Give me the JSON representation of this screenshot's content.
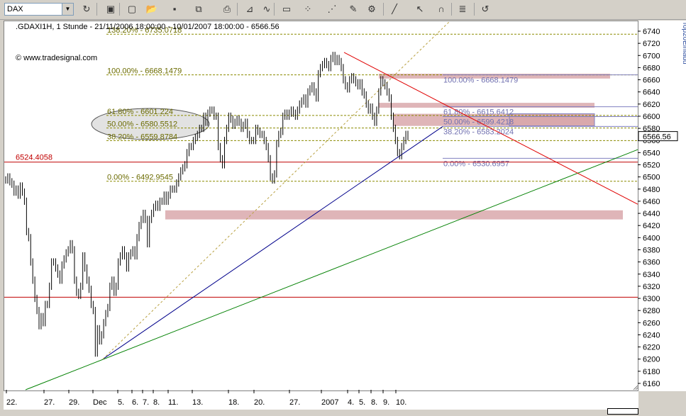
{
  "toolbar": {
    "symbol": "DAX",
    "icons": [
      "refresh-icon",
      "new-window-icon",
      "new-document-icon",
      "open-folder-icon",
      "save-icon",
      "copy-icon",
      "print-icon",
      "chart-window-icon",
      "indicator-icon",
      "bar-chart-icon",
      "scatter-icon",
      "trend-tools-icon",
      "drawing-tools-icon",
      "properties-icon",
      "cursor-icon",
      "arrow-pointer-icon",
      "magnet-icon",
      "list-icon",
      "undo-icon"
    ]
  },
  "chart": {
    "header": ".GDAXI1H, 1 Stunde - 21/11/2006 18:00:00 - 10/01/2007 18:00:00 - 6566.56",
    "watermark": "www.tradesignal.com",
    "sidebar_text": "Top20Einladu"
  },
  "chart_data": {
    "type": "bar",
    "subtype": "ohlc",
    "title": ".GDAXI1H, 1 Stunde - 21/11/2006 18:00:00 - 10/01/2007 18:00:00 - 6566.56",
    "x_tick_labels": [
      "22.",
      "27.",
      "29.",
      "Dec",
      "5.",
      "6.",
      "7.",
      "8.",
      "11.",
      "13.",
      "18.",
      "20.",
      "27.",
      "2007",
      "4.",
      "5.",
      "8.",
      "9.",
      "10."
    ],
    "y_tick_labels": [
      6160,
      6180,
      6200,
      6220,
      6240,
      6260,
      6280,
      6300,
      6320,
      6340,
      6360,
      6380,
      6400,
      6420,
      6440,
      6460,
      6480,
      6500,
      6520,
      6540,
      6560,
      6580,
      6600,
      6620,
      6640,
      6660,
      6680,
      6700,
      6720,
      6740
    ],
    "ylim": [
      6150,
      6750
    ],
    "last_price": "6566.56",
    "left_fib_levels": [
      {
        "label": "138.20% - 6735.0718",
        "value": 6735.0718
      },
      {
        "label": "100.00% - 6668.1479",
        "value": 6668.1479
      },
      {
        "label": "61.80% - 6601.224",
        "value": 6601.224
      },
      {
        "label": "50.00% - 6580.5512",
        "value": 6580.5512
      },
      {
        "label": "38.20% - 6559.8784",
        "value": 6559.8784
      },
      {
        "label": "0.00% - 6492.9545",
        "value": 6492.9545
      }
    ],
    "right_fib_levels": [
      {
        "label": "100.00% - 6668.1479",
        "value": 6668.1479
      },
      {
        "label": "61.80% - 6615.6412",
        "value": 6615.6412
      },
      {
        "label": "50.00% - 6599.4218",
        "value": 6599.4218
      },
      {
        "label": "38.20% - 6583.2024",
        "value": 6583.2024
      },
      {
        "label": "0.00% - 6530.6957",
        "value": 6530.6957
      }
    ],
    "horizontal_lines": [
      {
        "label": "6524.4058",
        "value": 6524.4058
      },
      {
        "value": 6302
      }
    ],
    "price_series": [
      6495,
      6500,
      6492,
      6488,
      6475,
      6480,
      6470,
      6485,
      6475,
      6460,
      6410,
      6400,
      6360,
      6330,
      6300,
      6280,
      6255,
      6270,
      6260,
      6290,
      6290,
      6320,
      6360,
      6360,
      6350,
      6340,
      6330,
      6355,
      6365,
      6375,
      6380,
      6390,
      6380,
      6330,
      6310,
      6305,
      6320,
      6370,
      6350,
      6330,
      6315,
      6290,
      6280,
      6210,
      6250,
      6230,
      6240,
      6260,
      6275,
      6285,
      6320,
      6330,
      6310,
      6320,
      6360,
      6370,
      6380,
      6370,
      6350,
      6370,
      6375,
      6380,
      6370,
      6400,
      6420,
      6430,
      6440,
      6430,
      6390,
      6430,
      6440,
      6450,
      6455,
      6450,
      6460,
      6460,
      6470,
      6460,
      6470,
      6480,
      6480,
      6480,
      6490,
      6500,
      6510,
      6515,
      6520,
      6540,
      6550,
      6550,
      6560,
      6565,
      6570,
      6580,
      6580,
      6600,
      6590,
      6605,
      6610,
      6610,
      6600,
      6600,
      6550,
      6530,
      6520,
      6560,
      6580,
      6600,
      6595,
      6585,
      6590,
      6595,
      6590,
      6580,
      6585,
      6590,
      6570,
      6560,
      6560,
      6560,
      6580,
      6575,
      6570,
      6570,
      6560,
      6550,
      6530,
      6500,
      6495,
      6505,
      6555,
      6570,
      6575,
      6600,
      6605,
      6600,
      6605,
      6610,
      6605,
      6600,
      6610,
      6620,
      6625,
      6630,
      6620,
      6640,
      6645,
      6650,
      6640,
      6630,
      6670,
      6680,
      6685,
      6690,
      6685,
      6680,
      6695,
      6700,
      6690,
      6695,
      6690,
      6680,
      6660,
      6650,
      6645,
      6660,
      6665,
      6660,
      6655,
      6650,
      6655,
      6640,
      6635,
      6620,
      6610,
      6615,
      6600,
      6590,
      6610,
      6640,
      6660,
      6655,
      6650,
      6640,
      6630,
      6600,
      6580,
      6560,
      6540,
      6535,
      6550,
      6560,
      6570,
      6566.56
    ],
    "zones": [
      {
        "name": "resistance-zone-top",
        "y_top": 6670,
        "y_bottom": 6662,
        "x_start_cat": "5.",
        "x_end": "chart-right"
      },
      {
        "name": "resistance-zone-mid",
        "y_top": 6622,
        "y_bottom": 6614
      },
      {
        "name": "resistance-zone-low",
        "y_top": 6604,
        "y_bottom": 6584
      },
      {
        "name": "support-zone",
        "y_top": 6445,
        "y_bottom": 6430
      }
    ],
    "ellipse_note": "oval highlight around 61.80% / 50.00% levels",
    "trendlines": [
      {
        "name": "green-uptrend",
        "color": "#008000"
      },
      {
        "name": "blue-uptrend",
        "color": "#00008b"
      },
      {
        "name": "red-downtrend",
        "color": "#e00000"
      },
      {
        "name": "dashed-uptrend",
        "color": "#b8a040"
      }
    ],
    "grid": false
  }
}
